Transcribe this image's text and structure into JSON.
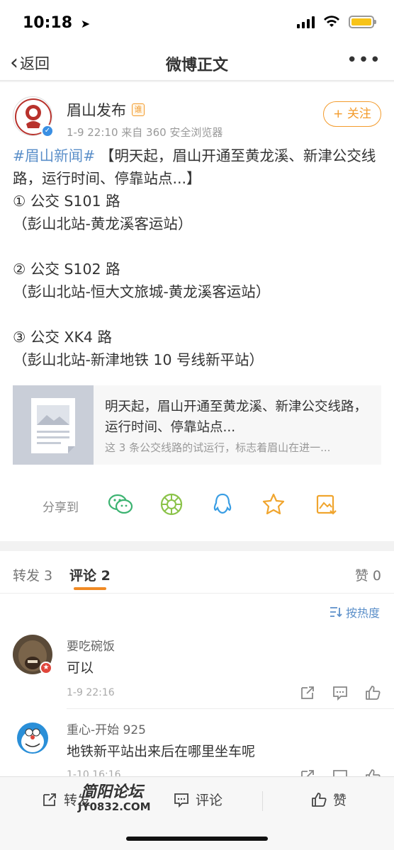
{
  "status": {
    "time": "10:18"
  },
  "nav": {
    "back_label": "返回",
    "title": "微博正文",
    "more": "•••"
  },
  "post": {
    "username": "眉山发布",
    "vip_badge": "谁",
    "meta": "1-9 22:10  来自 360 安全浏览器",
    "follow_label": "+ 关注",
    "topic": "#眉山新闻#",
    "headline": "【明天起，眉山开通至黄龙溪、新津公交线路，运行时间、停靠站点...】",
    "routes": [
      {
        "name": "① 公交 S101 路",
        "stops": "（彭山北站-黄龙溪客运站）"
      },
      {
        "name": "② 公交 S102 路",
        "stops": "（彭山北站-恒大文旅城-黄龙溪客运站）"
      },
      {
        "name": "③ 公交 XK4 路",
        "stops": "（彭山北站-新津地铁 10 号线新平站）"
      }
    ],
    "link_card": {
      "title": "明天起，眉山开通至黄龙溪、新津公交线路，运行时间、停靠站点...",
      "desc": "这 3 条公交线路的试运行，标志着眉山在进一..."
    },
    "share_label": "分享到"
  },
  "tabs": {
    "repost": "转发 3",
    "comment": "评论 2",
    "like": "赞 0"
  },
  "comments": {
    "sort_label": "按热度",
    "items": [
      {
        "name": "要吃碗饭",
        "text": "可以",
        "time": "1-9 22:16"
      },
      {
        "name": "重心-开始 925",
        "text": "地铁新平站出来后在哪里坐车呢",
        "time": "1-10 16:16"
      }
    ]
  },
  "bottombar": {
    "repost": "转发",
    "comment": "评论",
    "like": "赞"
  },
  "watermark": {
    "top": "简阳论坛",
    "bottom": "JY0832.COM"
  },
  "colors": {
    "accent": "#f39b2c",
    "link": "#5b8fc9",
    "tab_underline": "#f08a24"
  }
}
